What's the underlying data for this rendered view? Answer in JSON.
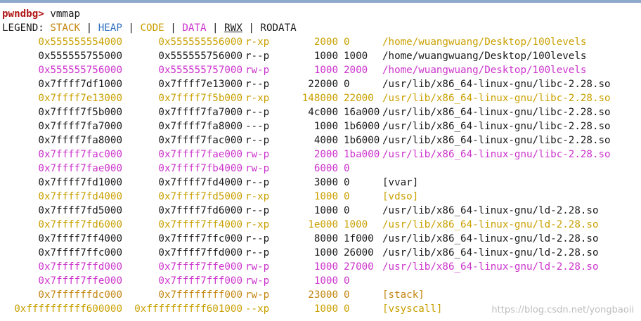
{
  "prompt": {
    "name": "pwndbg>",
    "command": "vmmap"
  },
  "legend": {
    "label": "LEGEND:",
    "items": [
      "STACK",
      "HEAP",
      "CODE",
      "DATA",
      "RWX",
      "RODATA"
    ],
    "separator": "|"
  },
  "colors": {
    "prompt": "#b01515",
    "stack": "#c4860f",
    "heap": "#2f6fbf",
    "code": "#c9a000",
    "data": "#cc33cc",
    "rodata": "#1a1a1a",
    "topbar": "#8fa9cc"
  },
  "mappings": [
    {
      "start": "0x555555554000",
      "end": "0x555555556000",
      "perm": "r-xp",
      "size": "2000",
      "offset": "0",
      "path": "/home/wuangwuang/Desktop/100levels",
      "kind": "code"
    },
    {
      "start": "0x555555755000",
      "end": "0x555555756000",
      "perm": "r--p",
      "size": "1000",
      "offset": "1000",
      "path": "/home/wuangwuang/Desktop/100levels",
      "kind": "rodata"
    },
    {
      "start": "0x555555756000",
      "end": "0x555555757000",
      "perm": "rw-p",
      "size": "1000",
      "offset": "2000",
      "path": "/home/wuangwuang/Desktop/100levels",
      "kind": "data"
    },
    {
      "start": "0x7ffff7df1000",
      "end": "0x7ffff7e13000",
      "perm": "r--p",
      "size": "22000",
      "offset": "0",
      "path": "/usr/lib/x86_64-linux-gnu/libc-2.28.so",
      "kind": "rodata"
    },
    {
      "start": "0x7ffff7e13000",
      "end": "0x7ffff7f5b000",
      "perm": "r-xp",
      "size": "148000",
      "offset": "22000",
      "path": "/usr/lib/x86_64-linux-gnu/libc-2.28.so",
      "kind": "code"
    },
    {
      "start": "0x7ffff7f5b000",
      "end": "0x7ffff7fa7000",
      "perm": "r--p",
      "size": "4c000",
      "offset": "16a000",
      "path": "/usr/lib/x86_64-linux-gnu/libc-2.28.so",
      "kind": "rodata"
    },
    {
      "start": "0x7ffff7fa7000",
      "end": "0x7ffff7fa8000",
      "perm": "---p",
      "size": "1000",
      "offset": "1b6000",
      "path": "/usr/lib/x86_64-linux-gnu/libc-2.28.so",
      "kind": "rodata"
    },
    {
      "start": "0x7ffff7fa8000",
      "end": "0x7ffff7fac000",
      "perm": "r--p",
      "size": "4000",
      "offset": "1b6000",
      "path": "/usr/lib/x86_64-linux-gnu/libc-2.28.so",
      "kind": "rodata"
    },
    {
      "start": "0x7ffff7fac000",
      "end": "0x7ffff7fae000",
      "perm": "rw-p",
      "size": "2000",
      "offset": "1ba000",
      "path": "/usr/lib/x86_64-linux-gnu/libc-2.28.so",
      "kind": "data"
    },
    {
      "start": "0x7ffff7fae000",
      "end": "0x7ffff7fb4000",
      "perm": "rw-p",
      "size": "6000",
      "offset": "0",
      "path": "",
      "kind": "data"
    },
    {
      "start": "0x7ffff7fd1000",
      "end": "0x7ffff7fd4000",
      "perm": "r--p",
      "size": "3000",
      "offset": "0",
      "path": "[vvar]",
      "kind": "rodata"
    },
    {
      "start": "0x7ffff7fd4000",
      "end": "0x7ffff7fd5000",
      "perm": "r-xp",
      "size": "1000",
      "offset": "0",
      "path": "[vdso]",
      "kind": "code"
    },
    {
      "start": "0x7ffff7fd5000",
      "end": "0x7ffff7fd6000",
      "perm": "r--p",
      "size": "1000",
      "offset": "0",
      "path": "/usr/lib/x86_64-linux-gnu/ld-2.28.so",
      "kind": "rodata"
    },
    {
      "start": "0x7ffff7fd6000",
      "end": "0x7ffff7ff4000",
      "perm": "r-xp",
      "size": "1e000",
      "offset": "1000",
      "path": "/usr/lib/x86_64-linux-gnu/ld-2.28.so",
      "kind": "code"
    },
    {
      "start": "0x7ffff7ff4000",
      "end": "0x7ffff7ffc000",
      "perm": "r--p",
      "size": "8000",
      "offset": "1f000",
      "path": "/usr/lib/x86_64-linux-gnu/ld-2.28.so",
      "kind": "rodata"
    },
    {
      "start": "0x7ffff7ffc000",
      "end": "0x7ffff7ffd000",
      "perm": "r--p",
      "size": "1000",
      "offset": "26000",
      "path": "/usr/lib/x86_64-linux-gnu/ld-2.28.so",
      "kind": "rodata"
    },
    {
      "start": "0x7ffff7ffd000",
      "end": "0x7ffff7ffe000",
      "perm": "rw-p",
      "size": "1000",
      "offset": "27000",
      "path": "/usr/lib/x86_64-linux-gnu/ld-2.28.so",
      "kind": "data"
    },
    {
      "start": "0x7ffff7ffe000",
      "end": "0x7ffff7fff000",
      "perm": "rw-p",
      "size": "1000",
      "offset": "0",
      "path": "",
      "kind": "data"
    },
    {
      "start": "0x7ffffffdc000",
      "end": "0x7ffffffff000",
      "perm": "rw-p",
      "size": "23000",
      "offset": "0",
      "path": "[stack]",
      "kind": "stack"
    },
    {
      "start": "0xffffffffff600000",
      "end": "0xffffffffff601000",
      "perm": "--xp",
      "size": "1000",
      "offset": "0",
      "path": "[vsyscall]",
      "kind": "code"
    }
  ],
  "watermark": "https://blog.csdn.net/yongbaoii"
}
